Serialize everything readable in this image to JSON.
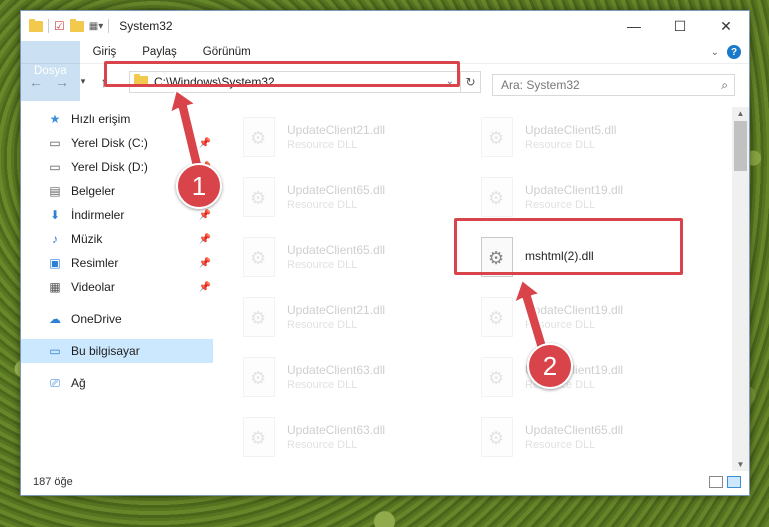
{
  "window": {
    "title": "System32",
    "controls": {
      "minimize": "—",
      "maximize": "☐",
      "close": "✕"
    }
  },
  "ribbon": {
    "tabs": [
      "Dosya",
      "Giriş",
      "Paylaş",
      "Görünüm"
    ]
  },
  "address": {
    "path": "C:\\Windows\\System32"
  },
  "search": {
    "placeholder": "Ara: System32"
  },
  "sidebar": {
    "quick_access": "Hızlı erişim",
    "items": [
      {
        "label": "Yerel Disk (C:)",
        "icon": "drive-icon",
        "pinned": true
      },
      {
        "label": "Yerel Disk (D:)",
        "icon": "drive-icon",
        "pinned": true
      },
      {
        "label": "Belgeler",
        "icon": "documents-icon",
        "pinned": true
      },
      {
        "label": "İndirmeler",
        "icon": "download-icon",
        "pinned": true
      },
      {
        "label": "Müzik",
        "icon": "music-icon",
        "pinned": true
      },
      {
        "label": "Resimler",
        "icon": "pictures-icon",
        "pinned": true
      },
      {
        "label": "Videolar",
        "icon": "videos-icon",
        "pinned": true
      }
    ],
    "onedrive": "OneDrive",
    "this_pc": "Bu bilgisayar",
    "network": "Ağ"
  },
  "files": [
    {
      "name": "UpdateClient21.dll",
      "type": "Resource DLL"
    },
    {
      "name": "UpdateClient5.dll",
      "type": "Resource DLL"
    },
    {
      "name": "UpdateClient65.dll",
      "type": "Resource DLL"
    },
    {
      "name": "UpdateClient19.dll",
      "type": "Resource DLL"
    },
    {
      "name": "UpdateClient65.dll",
      "type": "Resource DLL"
    },
    {
      "name": "mshtml(2).dll",
      "type": "",
      "highlighted": true
    },
    {
      "name": "UpdateClient21.dll",
      "type": "Resource DLL"
    },
    {
      "name": "UpdateClient19.dll",
      "type": "Resource DLL"
    },
    {
      "name": "UpdateClient63.dll",
      "type": "Resource DLL"
    },
    {
      "name": "UpdateClient19.dll",
      "type": "Resource DLL"
    },
    {
      "name": "UpdateClient63.dll",
      "type": "Resource DLL"
    },
    {
      "name": "UpdateClient65.dll",
      "type": "Resource DLL"
    }
  ],
  "status": {
    "count": "187 öğe"
  },
  "annotations": {
    "step1": "1",
    "step2": "2",
    "color": "#d9434a"
  }
}
